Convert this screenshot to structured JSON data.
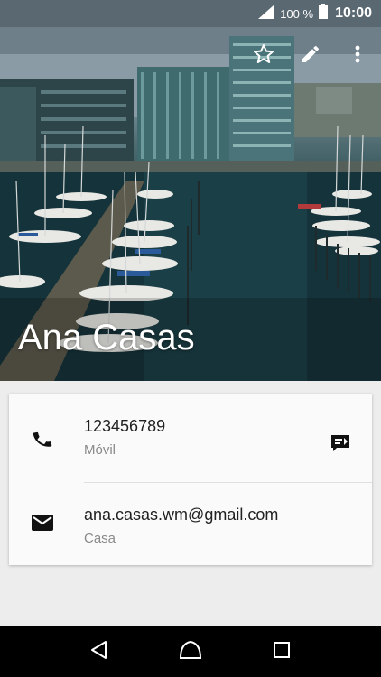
{
  "status_bar": {
    "battery_percent": "100 %",
    "time": "10:00",
    "signal_icon": "cell-signal-icon",
    "battery_icon": "battery-full-icon"
  },
  "toolbar": {
    "icons": [
      "star-outline-icon",
      "pencil-edit-icon",
      "more-vert-icon"
    ]
  },
  "contact": {
    "name": "Ana Casas",
    "header_image": "marina-harbor-photo"
  },
  "details": {
    "phone": {
      "value": "123456789",
      "type": "Móvil",
      "icon": "phone-icon",
      "action_icon": "message-icon"
    },
    "email": {
      "value": "ana.casas.wm@gmail.com",
      "type": "Casa",
      "icon": "email-icon"
    }
  },
  "nav_bar": {
    "icons": [
      "back-icon",
      "home-icon",
      "recents-icon"
    ]
  },
  "colors": {
    "card_bg": "#fafafa",
    "page_bg": "#ededed",
    "primary_text": "#212121",
    "secondary_text": "#8a8a8a"
  }
}
